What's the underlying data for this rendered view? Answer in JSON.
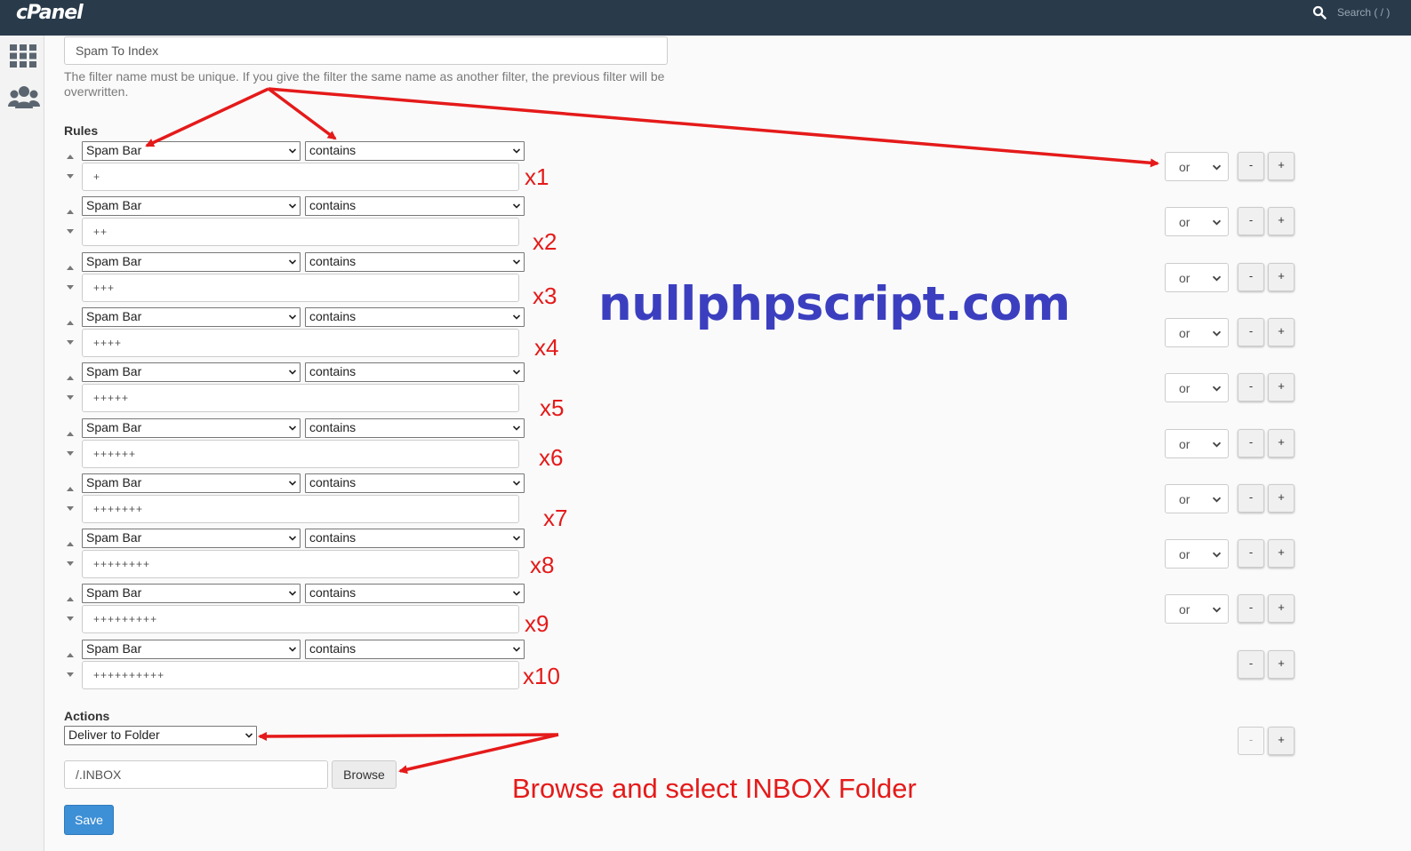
{
  "header": {
    "logo": "cPanel",
    "search_placeholder": "Search ( / )"
  },
  "sidebar": {
    "icons": [
      "apps-grid-icon",
      "users-icon"
    ]
  },
  "filter": {
    "name_value": "Spam To Index",
    "help_text": "The filter name must be unique. If you give the filter the same name as another filter, the previous filter will be overwritten."
  },
  "rules": {
    "label": "Rules",
    "items": [
      {
        "field": "Spam Bar",
        "operator": "contains",
        "value": "+",
        "conjunction": "or"
      },
      {
        "field": "Spam Bar",
        "operator": "contains",
        "value": "++",
        "conjunction": "or"
      },
      {
        "field": "Spam Bar",
        "operator": "contains",
        "value": "+++",
        "conjunction": "or"
      },
      {
        "field": "Spam Bar",
        "operator": "contains",
        "value": "++++",
        "conjunction": "or"
      },
      {
        "field": "Spam Bar",
        "operator": "contains",
        "value": "+++++",
        "conjunction": "or"
      },
      {
        "field": "Spam Bar",
        "operator": "contains",
        "value": "++++++",
        "conjunction": "or"
      },
      {
        "field": "Spam Bar",
        "operator": "contains",
        "value": "+++++++",
        "conjunction": "or"
      },
      {
        "field": "Spam Bar",
        "operator": "contains",
        "value": "++++++++",
        "conjunction": "or"
      },
      {
        "field": "Spam Bar",
        "operator": "contains",
        "value": "+++++++++",
        "conjunction": "or"
      },
      {
        "field": "Spam Bar",
        "operator": "contains",
        "value": "++++++++++",
        "conjunction": ""
      }
    ],
    "remove_label": "-",
    "add_label": "+"
  },
  "actions": {
    "label": "Actions",
    "action": "Deliver to Folder",
    "folder_value": "/.INBOX",
    "browse_label": "Browse",
    "remove_label": "-",
    "add_label": "+"
  },
  "save_label": "Save",
  "annotations": {
    "counts": [
      "x1",
      "x2",
      "x3",
      "x4",
      "x5",
      "x6",
      "x7",
      "x8",
      "x9",
      "x10"
    ],
    "watermark": "nullphpscript.com",
    "browse_note": "Browse and select INBOX Folder",
    "color": "#e51a1a"
  }
}
